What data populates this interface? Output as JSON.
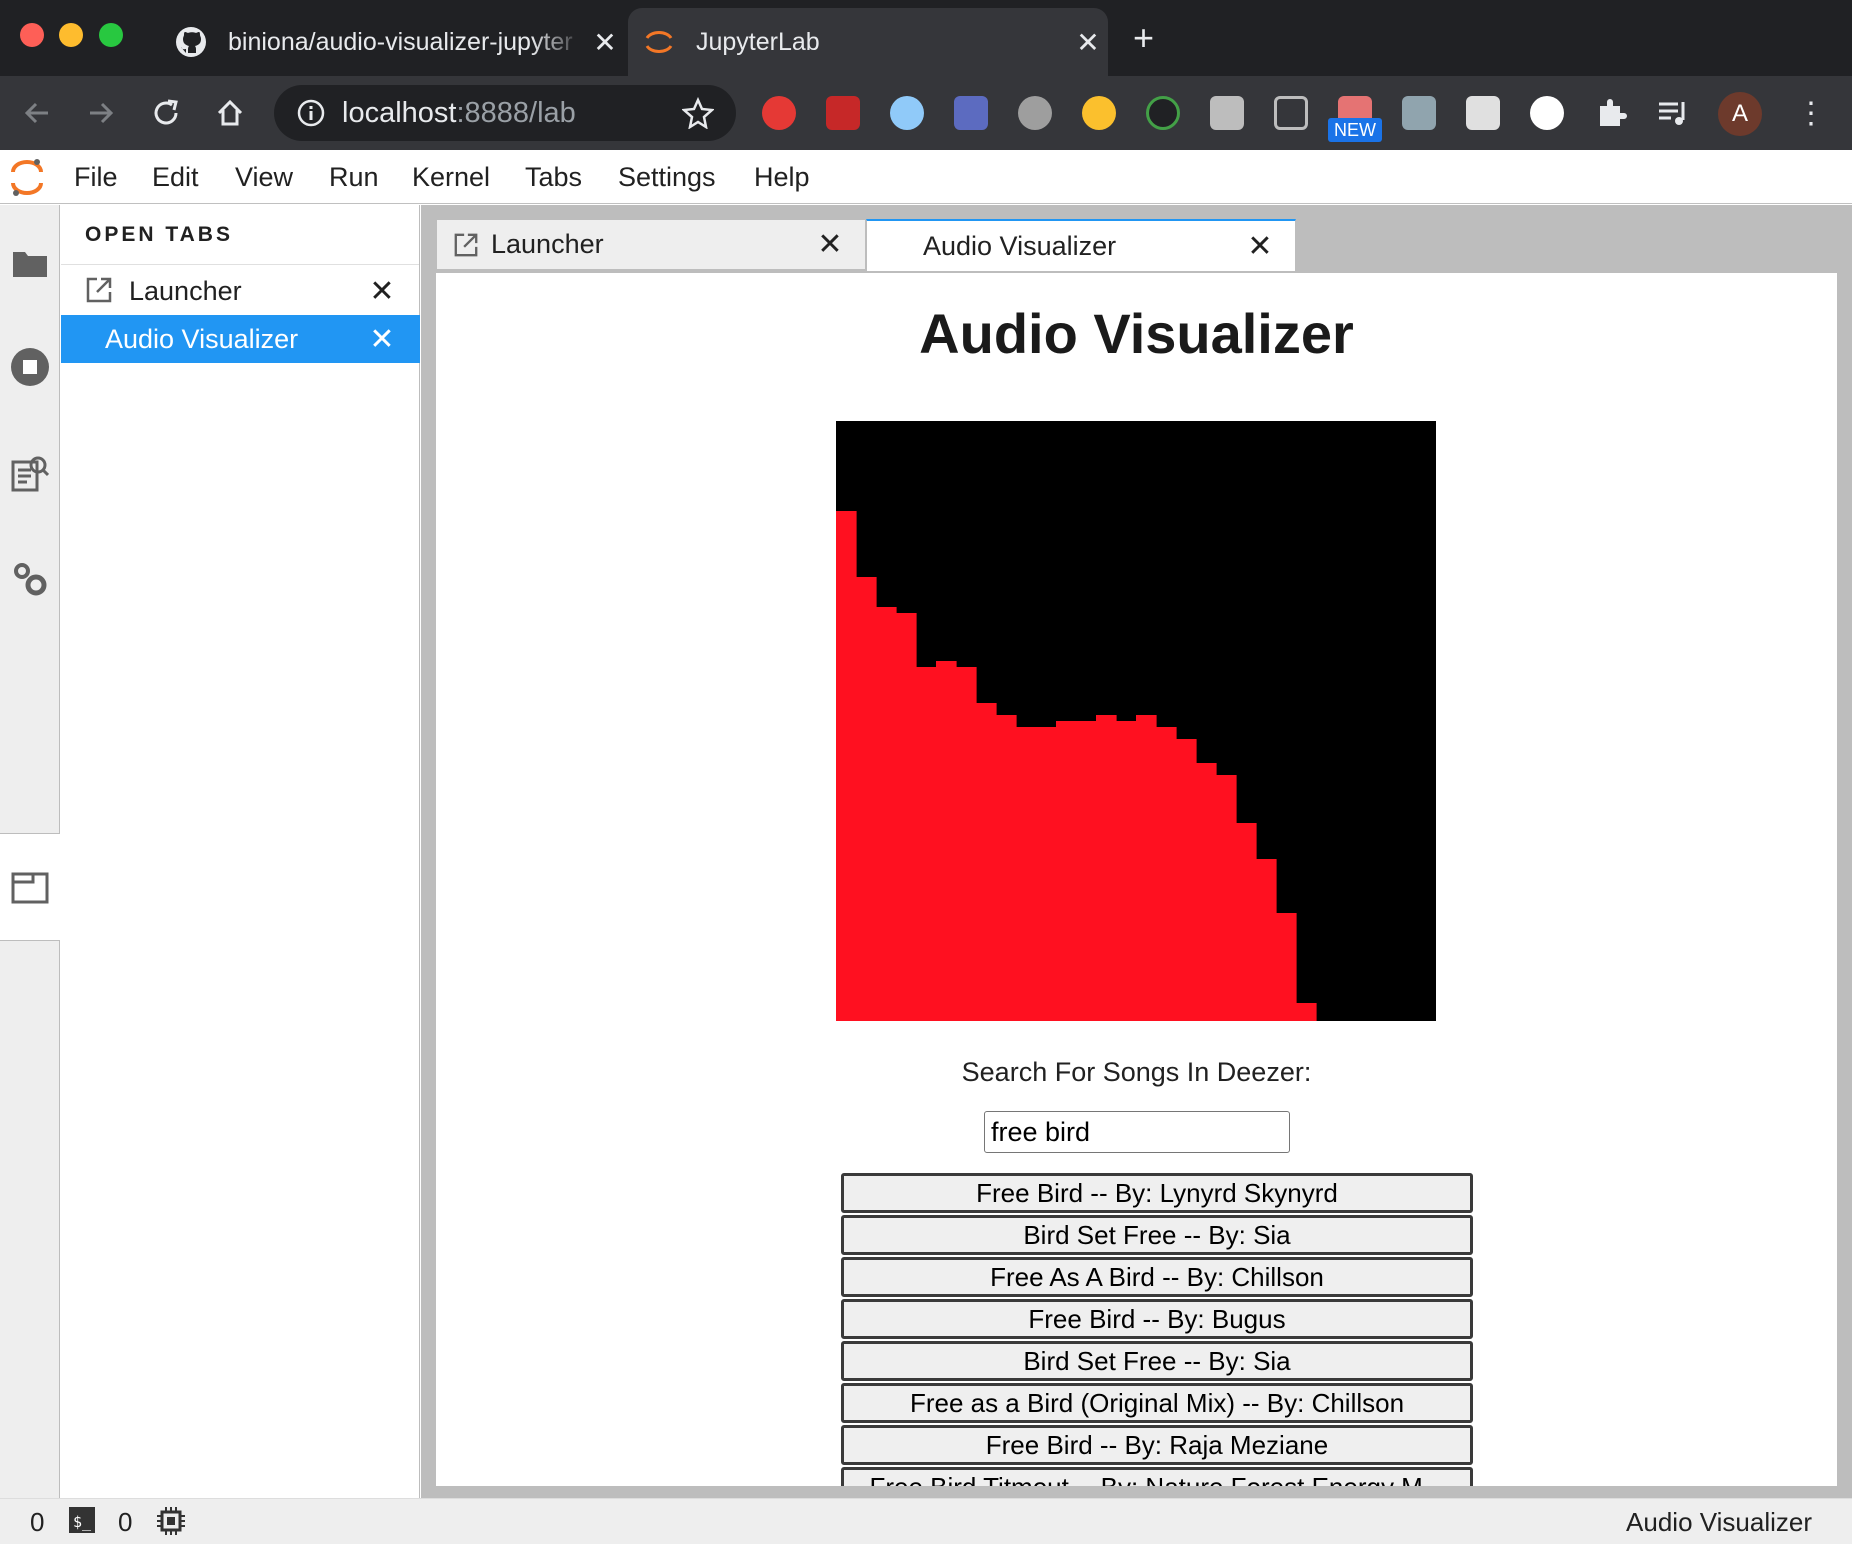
{
  "browser": {
    "tabs": [
      {
        "title": "biniona/audio-visualizer-jupyter",
        "icon": "github-icon"
      },
      {
        "title": "JupyterLab",
        "icon": "jupyter-icon"
      }
    ],
    "url_host": "localhost",
    "url_rest": ":8888/lab",
    "new_badge": "NEW",
    "avatar_letter": "A"
  },
  "menubar": {
    "items": [
      "File",
      "Edit",
      "View",
      "Run",
      "Kernel",
      "Tabs",
      "Settings",
      "Help"
    ]
  },
  "left_panel": {
    "header": "OPEN TABS",
    "tabs": [
      {
        "label": "Launcher"
      },
      {
        "label": "Audio Visualizer",
        "selected": true
      }
    ]
  },
  "doc_tabs": [
    {
      "label": "Launcher"
    },
    {
      "label": "Audio Visualizer",
      "active": true
    }
  ],
  "app": {
    "title": "Audio Visualizer",
    "search_label": "Search For Songs In Deezer:",
    "search_value": "free bird",
    "results": [
      "Free Bird -- By: Lynyrd Skynyrd",
      "Bird Set Free -- By: Sia",
      "Free As A Bird -- By: Chillson",
      "Free Bird -- By: Bugus",
      "Bird Set Free -- By: Sia",
      "Free as a Bird (Original Mix) -- By: Chillson",
      "Free Bird -- By: Raja Meziane",
      "Free Bird Titmout -- By: Nature Forest Energy M..."
    ]
  },
  "chart_data": {
    "type": "bar",
    "bar_color": "#ff1020",
    "background": "#000000",
    "ylim": [
      0,
      1
    ],
    "values": [
      0.85,
      0.74,
      0.69,
      0.68,
      0.59,
      0.6,
      0.59,
      0.53,
      0.51,
      0.49,
      0.49,
      0.5,
      0.5,
      0.51,
      0.5,
      0.51,
      0.49,
      0.47,
      0.43,
      0.41,
      0.33,
      0.27,
      0.18,
      0.03,
      0.0,
      0.0,
      0.0,
      0.0,
      0.0,
      0.0
    ]
  },
  "statusbar": {
    "terminals": "0",
    "kernels": "0",
    "right_text": "Audio Visualizer"
  },
  "colors": {
    "accent": "#2196f3",
    "jupyter_orange": "#f37726"
  }
}
